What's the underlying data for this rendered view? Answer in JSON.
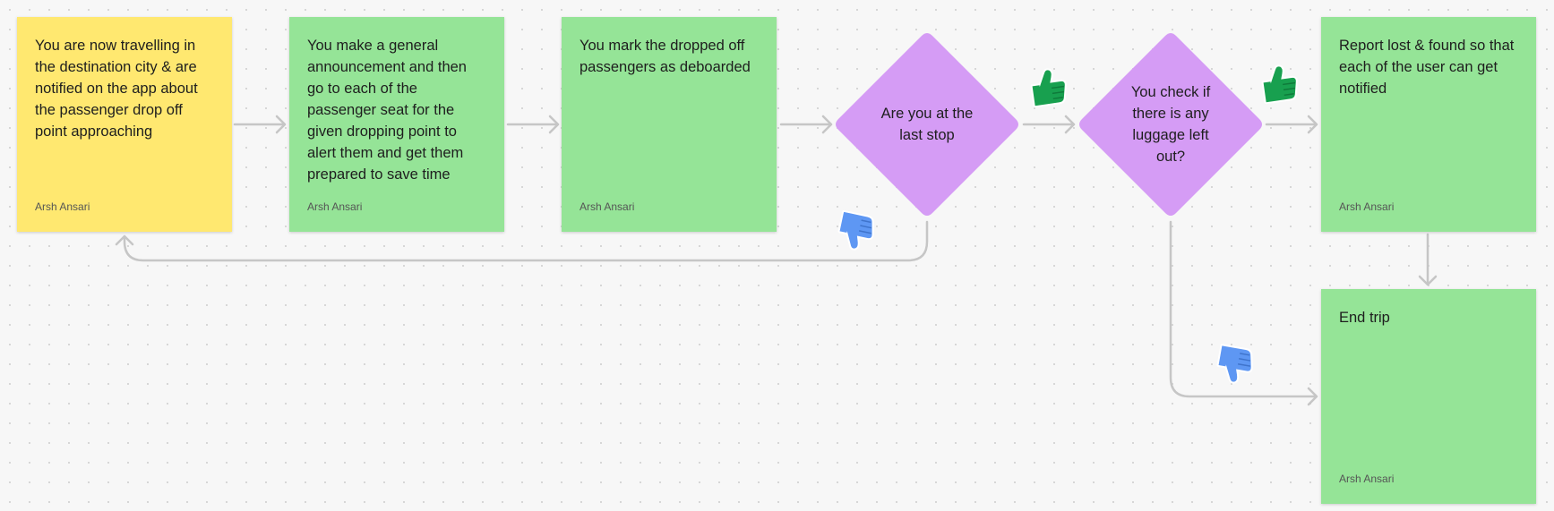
{
  "colors": {
    "yellow_note": "#ffe870",
    "green_note": "#95e497",
    "decision": "#d59cf5",
    "connector": "#c6c6c6",
    "thumbs_up": "#18a04f",
    "thumbs_down": "#5e97f3"
  },
  "notes": [
    {
      "text": "You are now travelling in the destination city & are notified on the app about the passenger drop off point approaching",
      "author": "Arsh Ansari"
    },
    {
      "text": "You make a general announcement and then go to each of the passenger seat for the given dropping point to alert them and get them prepared to save time",
      "author": "Arsh Ansari"
    },
    {
      "text": "You mark the dropped off passengers as deboarded",
      "author": "Arsh Ansari"
    },
    {
      "text": "Report lost & found so that each of the user can get notified",
      "author": "Arsh Ansari"
    },
    {
      "text": "End trip",
      "author": "Arsh Ansari"
    }
  ],
  "decisions": [
    {
      "text": "Are you at the last stop"
    },
    {
      "text": "You check if there is any luggage left out?"
    }
  ],
  "stickers": {
    "yes_icon": "thumbs-up-icon",
    "no_icon": "thumbs-down-icon"
  }
}
